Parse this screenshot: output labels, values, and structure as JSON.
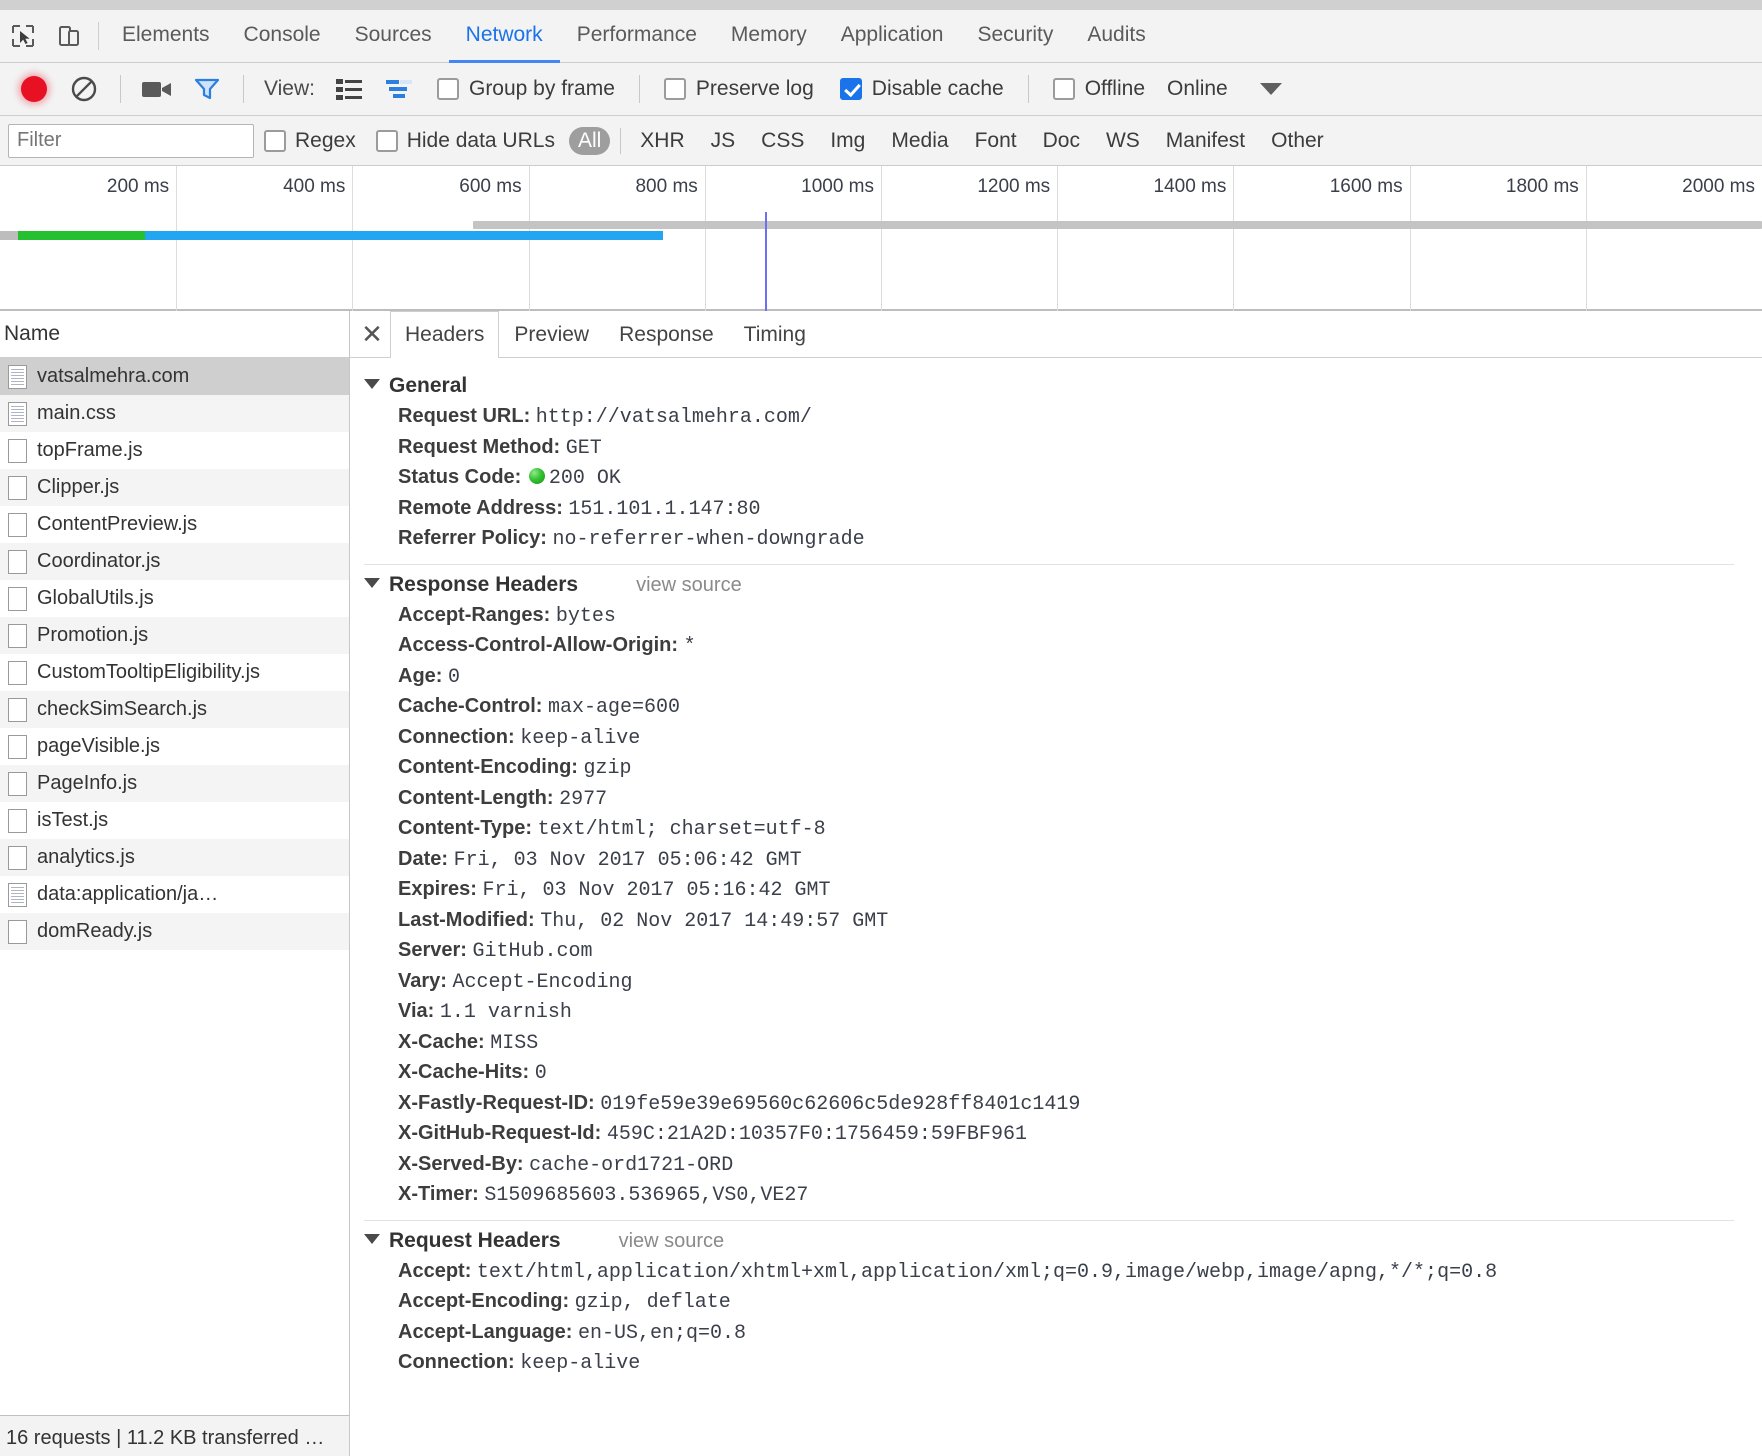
{
  "window": {
    "sliver_text": "·  ·   ··"
  },
  "devtools_tabs": {
    "inspect_icon": "cursor-select-icon",
    "device_icon": "device-toolbar-icon",
    "items": [
      {
        "label": "Elements",
        "active": false
      },
      {
        "label": "Console",
        "active": false
      },
      {
        "label": "Sources",
        "active": false
      },
      {
        "label": "Network",
        "active": true
      },
      {
        "label": "Performance",
        "active": false
      },
      {
        "label": "Memory",
        "active": false
      },
      {
        "label": "Application",
        "active": false
      },
      {
        "label": "Security",
        "active": false
      },
      {
        "label": "Audits",
        "active": false
      }
    ]
  },
  "network_toolbar": {
    "record_icon": "record-stop-icon",
    "clear_icon": "clear-no-entry-icon",
    "capture_screenshots_icon": "camera-icon",
    "filter_icon": "funnel-filter-icon",
    "view_label": "View:",
    "list_view_icon": "list-view-icon",
    "waterfall_view_icon": "waterfall-view-icon",
    "group_by_frame": {
      "label": "Group by frame",
      "checked": false
    },
    "preserve_log": {
      "label": "Preserve log",
      "checked": false
    },
    "disable_cache": {
      "label": "Disable cache",
      "checked": true
    },
    "offline": {
      "label": "Offline",
      "checked": false
    },
    "online_label": "Online",
    "more_icon": "chevron-down-icon"
  },
  "filter_bar": {
    "filter_placeholder": "Filter",
    "filter_value": "",
    "regex": {
      "label": "Regex",
      "checked": false
    },
    "hide_data_urls": {
      "label": "Hide data URLs",
      "checked": false
    },
    "type_pills": [
      {
        "label": "All",
        "selected": true
      },
      {
        "label": "XHR",
        "selected": false
      },
      {
        "label": "JS",
        "selected": false
      },
      {
        "label": "CSS",
        "selected": false
      },
      {
        "label": "Img",
        "selected": false
      },
      {
        "label": "Media",
        "selected": false
      },
      {
        "label": "Font",
        "selected": false
      },
      {
        "label": "Doc",
        "selected": false
      },
      {
        "label": "WS",
        "selected": false
      },
      {
        "label": "Manifest",
        "selected": false
      },
      {
        "label": "Other",
        "selected": false
      }
    ]
  },
  "overview": {
    "tick_labels": [
      "200 ms",
      "400 ms",
      "600 ms",
      "800 ms",
      "1000 ms",
      "1200 ms",
      "1400 ms",
      "1600 ms",
      "1800 ms",
      "2000 ms"
    ],
    "tick_interval_ms": 200,
    "max_ms": 2000
  },
  "requests": {
    "column_header": "Name",
    "items": [
      {
        "name": "vatsalmehra.com",
        "icon": "document-icon",
        "selected": true
      },
      {
        "name": "main.css",
        "icon": "stylesheet-icon",
        "selected": false
      },
      {
        "name": "topFrame.js",
        "icon": "script-icon",
        "selected": false
      },
      {
        "name": "Clipper.js",
        "icon": "script-icon",
        "selected": false
      },
      {
        "name": "ContentPreview.js",
        "icon": "script-icon",
        "selected": false
      },
      {
        "name": "Coordinator.js",
        "icon": "script-icon",
        "selected": false
      },
      {
        "name": "GlobalUtils.js",
        "icon": "script-icon",
        "selected": false
      },
      {
        "name": "Promotion.js",
        "icon": "script-icon",
        "selected": false
      },
      {
        "name": "CustomTooltipEligibility.js",
        "icon": "script-icon",
        "selected": false
      },
      {
        "name": "checkSimSearch.js",
        "icon": "script-icon",
        "selected": false
      },
      {
        "name": "pageVisible.js",
        "icon": "script-icon",
        "selected": false
      },
      {
        "name": "PageInfo.js",
        "icon": "script-icon",
        "selected": false
      },
      {
        "name": "isTest.js",
        "icon": "script-icon",
        "selected": false
      },
      {
        "name": "analytics.js",
        "icon": "script-icon",
        "selected": false
      },
      {
        "name": "data:application/ja…",
        "icon": "document-icon",
        "selected": false
      },
      {
        "name": "domReady.js",
        "icon": "script-icon",
        "selected": false
      }
    ]
  },
  "status_bar": {
    "text": "16 requests | 11.2 KB transferred …"
  },
  "detail": {
    "close_icon": "close-icon",
    "tabs": [
      {
        "label": "Headers",
        "active": true
      },
      {
        "label": "Preview",
        "active": false
      },
      {
        "label": "Response",
        "active": false
      },
      {
        "label": "Timing",
        "active": false
      }
    ],
    "view_source_label": "view source",
    "sections": [
      {
        "title": "General",
        "has_view_source": false,
        "rows": [
          {
            "key": "Request URL:",
            "value": "http://vatsalmehra.com/"
          },
          {
            "key": "Request Method:",
            "value": "GET"
          },
          {
            "key": "Status Code:",
            "value": "200 OK",
            "status_dot": true
          },
          {
            "key": "Remote Address:",
            "value": "151.101.1.147:80"
          },
          {
            "key": "Referrer Policy:",
            "value": "no-referrer-when-downgrade"
          }
        ]
      },
      {
        "title": "Response Headers",
        "has_view_source": true,
        "rows": [
          {
            "key": "Accept-Ranges:",
            "value": "bytes"
          },
          {
            "key": "Access-Control-Allow-Origin:",
            "value": "*"
          },
          {
            "key": "Age:",
            "value": "0"
          },
          {
            "key": "Cache-Control:",
            "value": "max-age=600"
          },
          {
            "key": "Connection:",
            "value": "keep-alive"
          },
          {
            "key": "Content-Encoding:",
            "value": "gzip"
          },
          {
            "key": "Content-Length:",
            "value": "2977"
          },
          {
            "key": "Content-Type:",
            "value": "text/html; charset=utf-8"
          },
          {
            "key": "Date:",
            "value": "Fri, 03 Nov 2017 05:06:42 GMT"
          },
          {
            "key": "Expires:",
            "value": "Fri, 03 Nov 2017 05:16:42 GMT"
          },
          {
            "key": "Last-Modified:",
            "value": "Thu, 02 Nov 2017 14:49:57 GMT"
          },
          {
            "key": "Server:",
            "value": "GitHub.com"
          },
          {
            "key": "Vary:",
            "value": "Accept-Encoding"
          },
          {
            "key": "Via:",
            "value": "1.1 varnish"
          },
          {
            "key": "X-Cache:",
            "value": "MISS"
          },
          {
            "key": "X-Cache-Hits:",
            "value": "0"
          },
          {
            "key": "X-Fastly-Request-ID:",
            "value": "019fe59e39e69560c62606c5de928ff8401c1419"
          },
          {
            "key": "X-GitHub-Request-Id:",
            "value": "459C:21A2D:10357F0:1756459:59FBF961"
          },
          {
            "key": "X-Served-By:",
            "value": "cache-ord1721-ORD"
          },
          {
            "key": "X-Timer:",
            "value": "S1509685603.536965,VS0,VE27"
          }
        ]
      },
      {
        "title": "Request Headers",
        "has_view_source": true,
        "rows": [
          {
            "key": "Accept:",
            "value": "text/html,application/xhtml+xml,application/xml;q=0.9,image/webp,image/apng,*/*;q=0.8"
          },
          {
            "key": "Accept-Encoding:",
            "value": "gzip, deflate"
          },
          {
            "key": "Accept-Language:",
            "value": "en-US,en;q=0.8"
          },
          {
            "key": "Connection:",
            "value": "keep-alive"
          }
        ]
      }
    ]
  },
  "colors": {
    "accent": "#4285f4",
    "record": "#e81123",
    "green": "#25c030",
    "blue": "#22a6f2",
    "status_ok": "#36c132"
  }
}
